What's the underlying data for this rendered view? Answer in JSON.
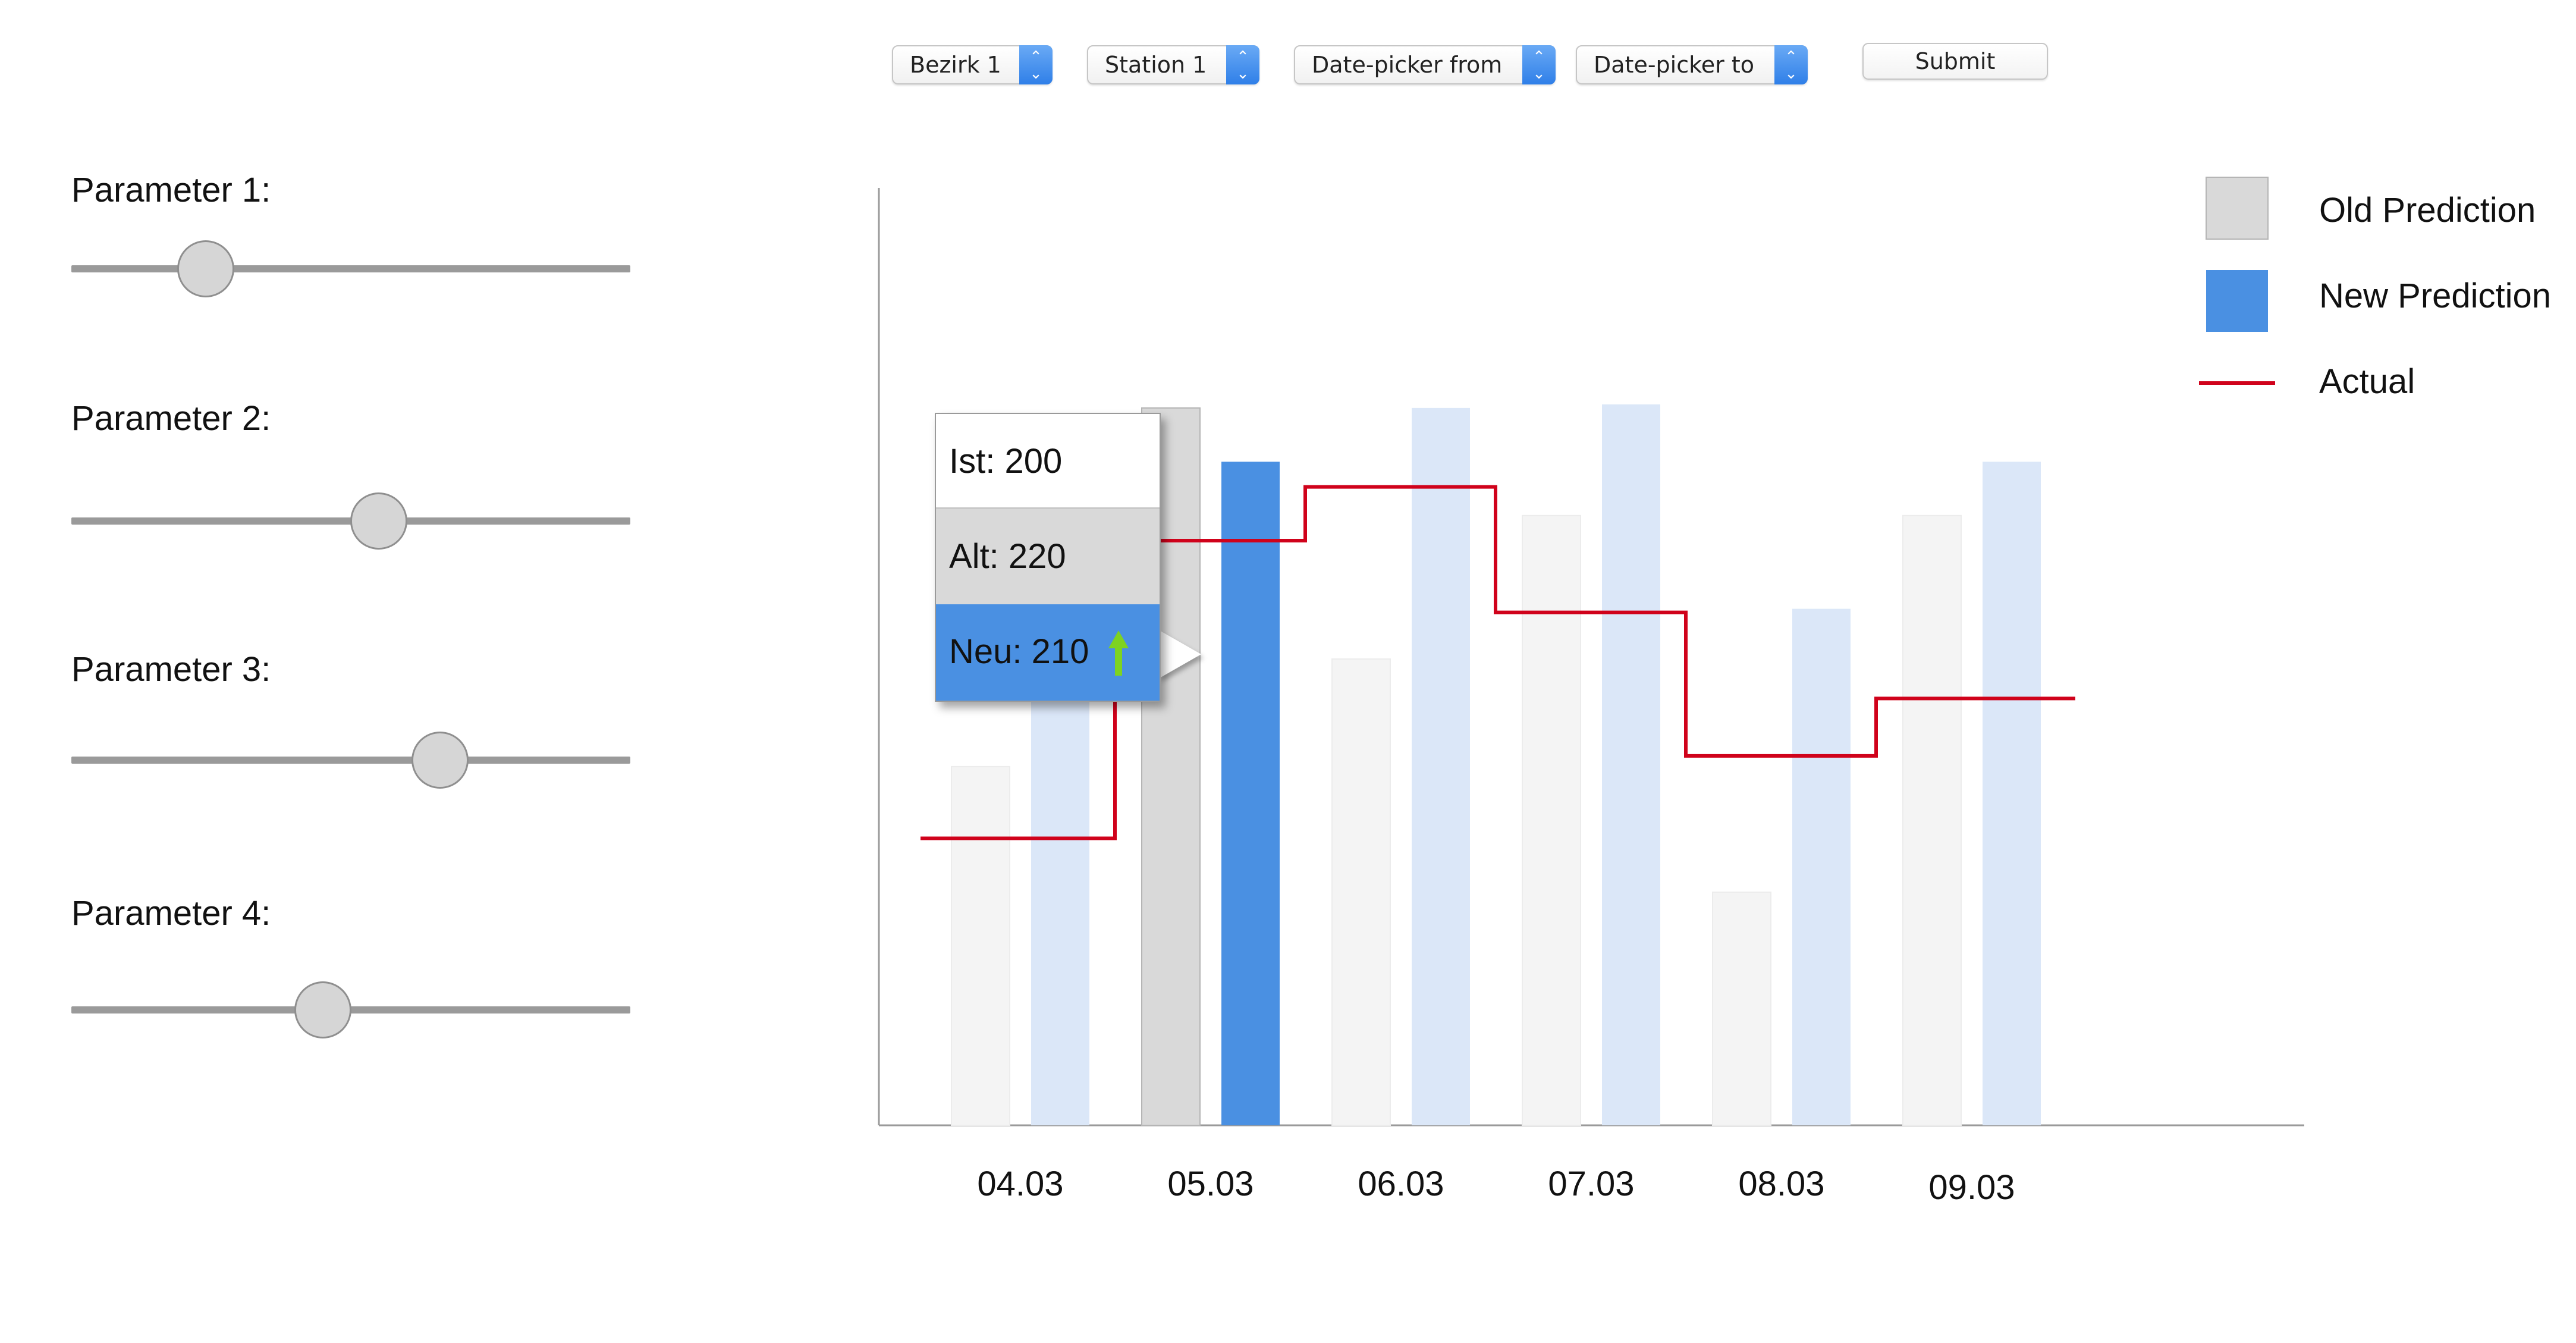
{
  "toolbar": {
    "district_select": "Bezirk 1",
    "station_select": "Station 1",
    "date_from": "Date-picker from",
    "date_to": "Date-picker to",
    "submit_label": "Submit",
    "select_icon": "updown-chevron-icon"
  },
  "parameters": [
    {
      "label": "Parameter 1:",
      "value": 0.24
    },
    {
      "label": "Parameter 2:",
      "value": 0.55
    },
    {
      "label": "Parameter 3:",
      "value": 0.66
    },
    {
      "label": "Parameter 4:",
      "value": 0.45
    }
  ],
  "legend": {
    "old": "Old Prediction",
    "new": "New Prediction",
    "actual": "Actual"
  },
  "tooltip": {
    "ist": "Ist: 200",
    "alt": "Alt: 220",
    "neu": "Neu: 210",
    "trend_icon": "green-up-arrow-icon"
  },
  "colors": {
    "old_prediction": "#d9d9d9",
    "old_prediction_faded": "#f4f4f4",
    "new_prediction": "#4a90e2",
    "new_prediction_faded": "#dbe7f8",
    "actual": "#d0021b",
    "trend_up": "#7ed321"
  },
  "chart_data": {
    "type": "bar",
    "categories": [
      "04.03",
      "05.03",
      "06.03",
      "07.03",
      "08.03",
      "09.03"
    ],
    "series": [
      {
        "name": "Old Prediction",
        "values": [
          100,
          200,
          130,
          170,
          65,
          170
        ]
      },
      {
        "name": "New Prediction",
        "values": [
          120,
          185,
          200,
          201,
          144,
          185
        ]
      },
      {
        "name": "Actual",
        "type": "step-line",
        "values": [
          80,
          163,
          178,
          143,
          103,
          119
        ]
      }
    ],
    "highlighted_category": "05.03",
    "ylim": [
      0,
      262
    ],
    "legend_position": "top-right",
    "grid": false
  }
}
